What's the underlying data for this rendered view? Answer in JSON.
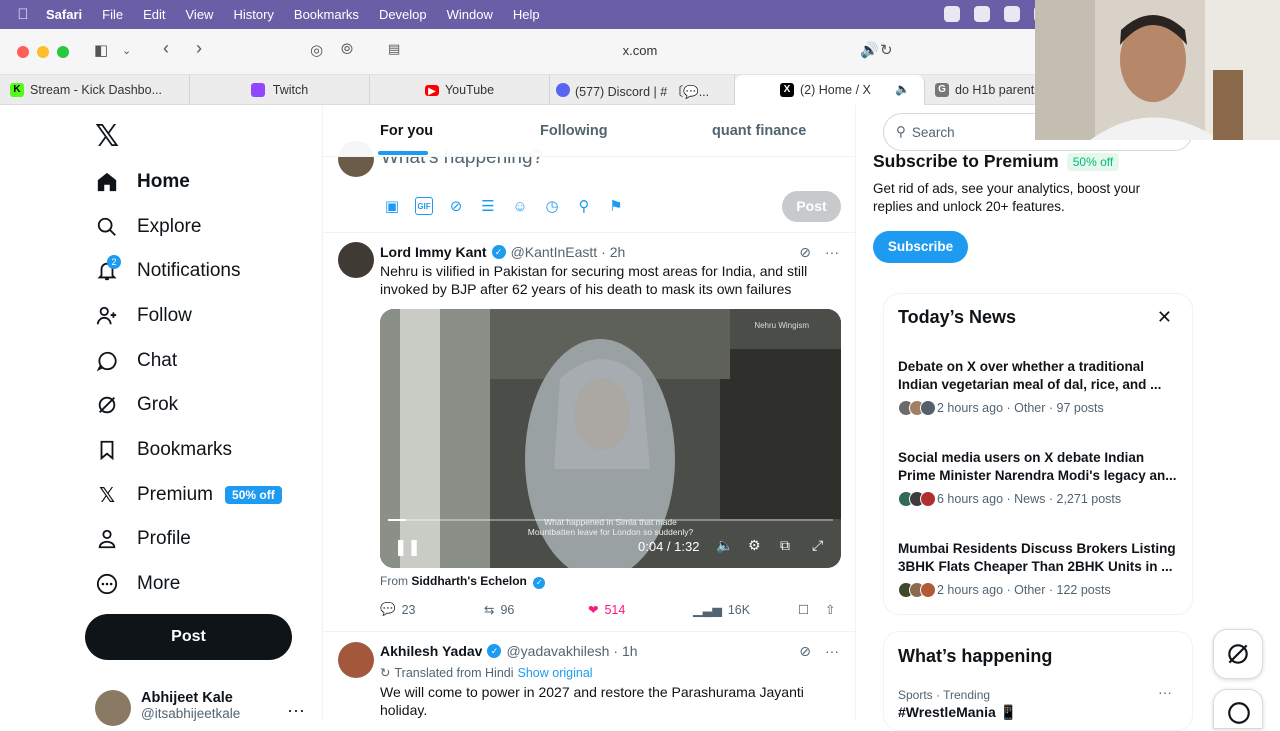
{
  "menubar": {
    "app": "Safari",
    "items": [
      "File",
      "Edit",
      "View",
      "History",
      "Bookmarks",
      "Develop",
      "Window",
      "Help"
    ]
  },
  "browser": {
    "url": "x.com",
    "tabs": [
      {
        "label": "Stream - Kick Dashbo...",
        "color": "#53fc18"
      },
      {
        "label": "Twitch",
        "color": "#9146ff"
      },
      {
        "label": "YouTube",
        "color": "#ff0000"
      },
      {
        "label": "(577) Discord | # 〔💬...",
        "color": "#5865f2"
      },
      {
        "label": "(2) Home / X",
        "color": "#000000"
      },
      {
        "label": "do H1b parents",
        "color": "#777777"
      }
    ]
  },
  "nav": {
    "items": [
      {
        "label": "Home",
        "icon": "home-icon"
      },
      {
        "label": "Explore",
        "icon": "search-icon"
      },
      {
        "label": "Notifications",
        "icon": "bell-icon",
        "badge": "2"
      },
      {
        "label": "Follow",
        "icon": "follow-icon"
      },
      {
        "label": "Chat",
        "icon": "chat-icon"
      },
      {
        "label": "Grok",
        "icon": "grok-icon"
      },
      {
        "label": "Bookmarks",
        "icon": "bookmark-icon"
      },
      {
        "label": "Premium",
        "icon": "x-icon",
        "badge": "50% off"
      },
      {
        "label": "Profile",
        "icon": "profile-icon"
      },
      {
        "label": "More",
        "icon": "more-icon"
      }
    ],
    "post_label": "Post",
    "user": {
      "name": "Abhijeet Kale",
      "handle": "@itsabhijeetkale"
    }
  },
  "feed": {
    "tabs": [
      "For you",
      "Following",
      "quant finance"
    ],
    "compose": {
      "placeholder": "What's happening?",
      "post_label": "Post"
    },
    "tweet1": {
      "name": "Lord Immy Kant",
      "handle": "@KantInEastt",
      "time": "· 2h",
      "text": "Nehru is vilified in Pakistan for securing most areas for India, and still invoked by BJP after 62 years of his death to mask its own failures",
      "video": {
        "watermark": "Nehru Wingism",
        "subtitle1": "What happened in Simla that made",
        "subtitle2": "Mountbatten leave for London so suddenly?",
        "time": "0:04 / 1:32",
        "progress": 0.04
      },
      "from_prefix": "From",
      "from_name": "Siddharth's Echelon",
      "replies": "23",
      "reposts": "96",
      "likes": "514",
      "views": "16K"
    },
    "tweet2": {
      "name": "Akhilesh Yadav",
      "handle": "@yadavakhilesh",
      "time": "· 1h",
      "translated": "Translated from Hindi",
      "show_original": "Show original",
      "text": "We will come to power in 2027 and restore the Parashurama Jayanti holiday."
    }
  },
  "right": {
    "search_placeholder": "Search",
    "premium": {
      "title": "Subscribe to Premium",
      "badge": "50% off",
      "text": "Get rid of ads, see your analytics, boost your replies and unlock 20+ features.",
      "button": "Subscribe"
    },
    "news": {
      "title": "Today’s News",
      "items": [
        {
          "headline": "Debate on X over whether a traditional Indian vegetarian meal of dal, rice, and ...",
          "meta": "2 hours ago · Other · 97 posts"
        },
        {
          "headline": "Social media users on X debate Indian Prime Minister Narendra Modi's legacy an...",
          "meta": "6 hours ago · News · 2,271 posts"
        },
        {
          "headline": "Mumbai Residents Discuss Brokers Listing 3BHK Flats Cheaper Than 2BHK Units in ...",
          "meta": "2 hours ago · Other · 122 posts"
        }
      ]
    },
    "happening": {
      "title": "What’s happening",
      "trend_meta": "Sports · Trending",
      "trend_name": "#WrestleMania 📱"
    }
  },
  "colors": {
    "accent": "#1d9bf0",
    "like": "#f91880",
    "menubar": "#6a5fa6"
  }
}
